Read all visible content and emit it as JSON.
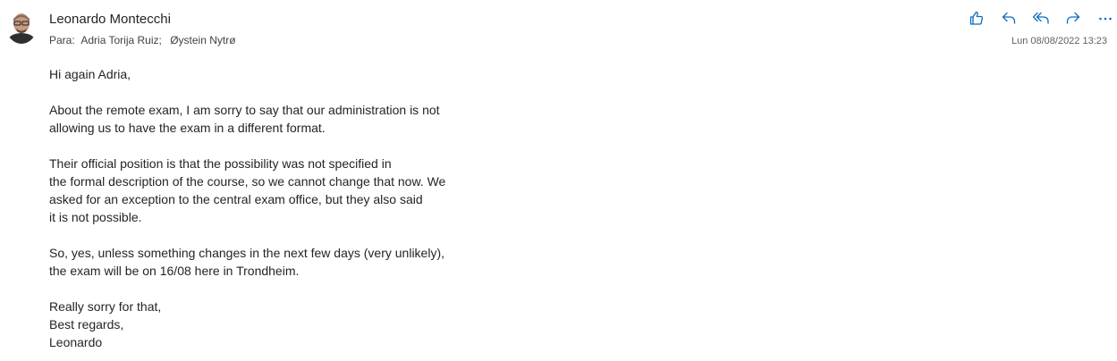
{
  "sender": {
    "name": "Leonardo Montecchi"
  },
  "recipients": {
    "label": "Para:",
    "names": [
      "Adria Torija Ruiz;",
      "Øystein Nytrø"
    ]
  },
  "datetime": "Lun 08/08/2022 13:23",
  "actions": [
    {
      "name": "like-icon"
    },
    {
      "name": "reply-icon"
    },
    {
      "name": "reply-all-icon"
    },
    {
      "name": "forward-icon"
    },
    {
      "name": "more-icon"
    }
  ],
  "body": {
    "greeting": "Hi again Adria,",
    "p1": [
      "About the remote exam, I am sorry to say that our administration is not",
      "allowing us to have the exam in a different format."
    ],
    "p2": [
      "Their official position is that the possibility was not specified in",
      "the formal description of the course, so we cannot change that now. We",
      "asked for an exception to the central exam office, but they also said",
      "it is not possible."
    ],
    "p3": [
      "So, yes, unless something changes in the next few days (very unlikely),",
      "the exam will be on 16/08 here in Trondheim."
    ],
    "closing": [
      "Really sorry for that,",
      "Best regards,",
      "Leonardo"
    ]
  },
  "colors": {
    "icon": "#0f6cbd",
    "text": "#242424",
    "muted": "#616161"
  }
}
